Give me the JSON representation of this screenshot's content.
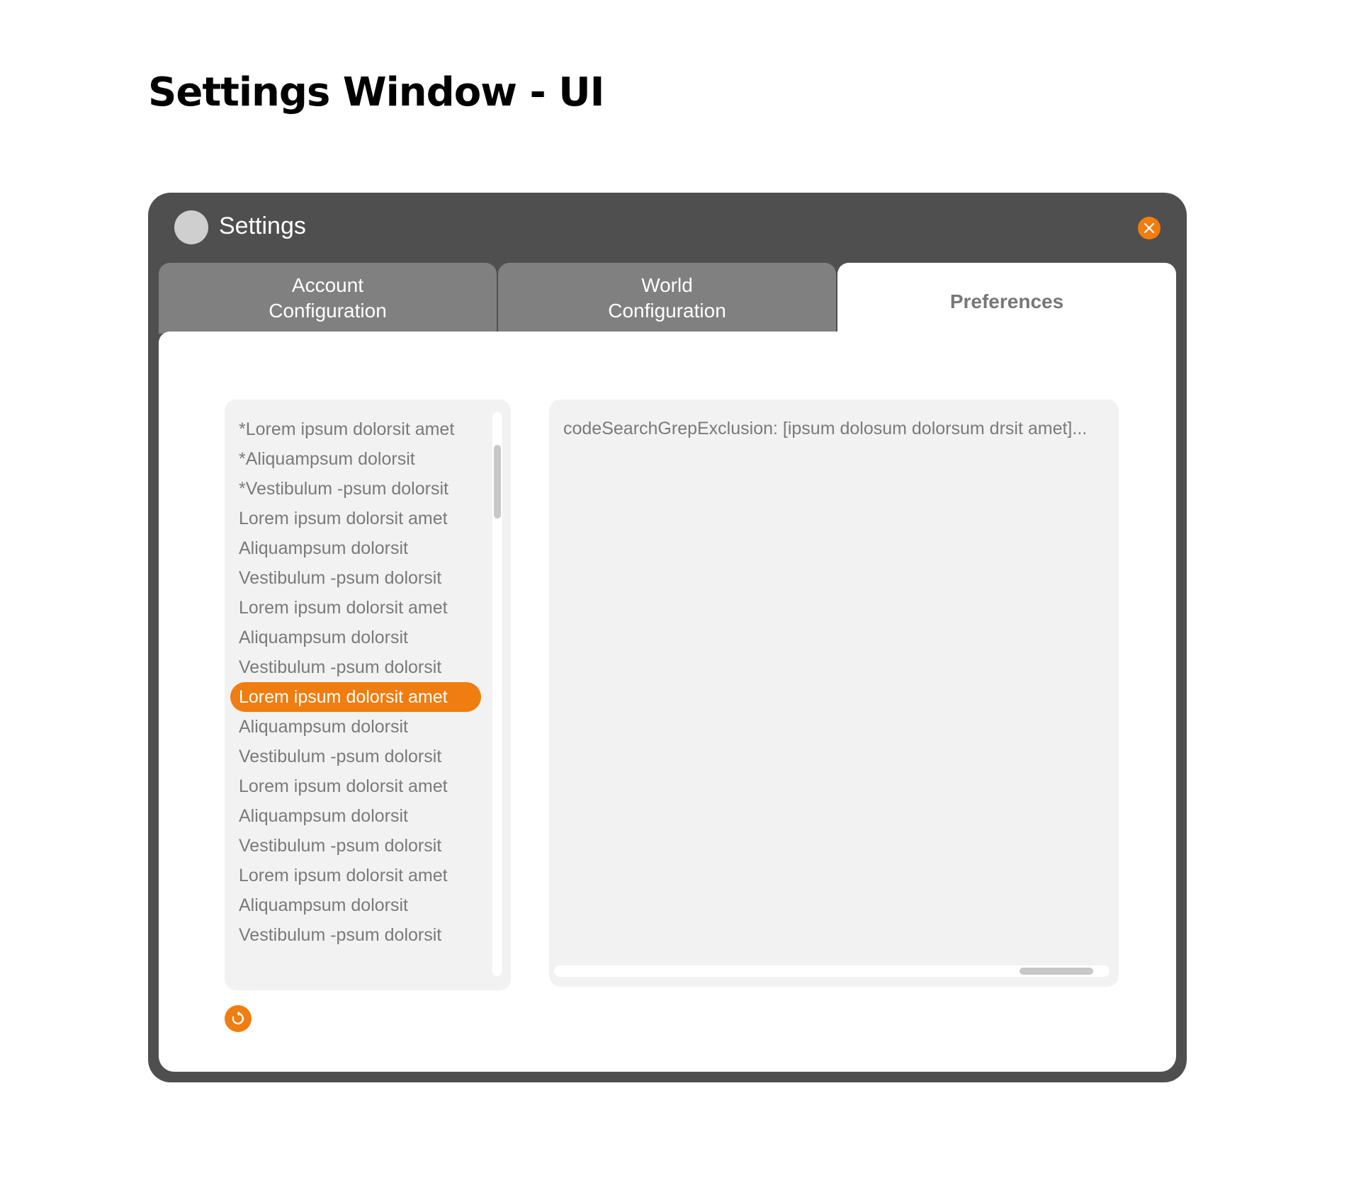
{
  "page": {
    "title": "Settings Window - UI"
  },
  "window": {
    "title": "Settings",
    "accent_color": "#f07d0f",
    "frame_color": "#4f4f4f",
    "close_icon": "close-icon",
    "refresh_icon": "refresh-icon"
  },
  "tabs": [
    {
      "label": "Account\nConfiguration",
      "active": false
    },
    {
      "label": "World\nConfiguration",
      "active": false
    },
    {
      "label": "Preferences",
      "active": true
    }
  ],
  "settings_list": {
    "selected_index": 9,
    "items": [
      "*Lorem ipsum dolorsit amet",
      "*Aliquampsum dolorsit",
      "*Vestibulum -psum dolorsit",
      "Lorem ipsum dolorsit amet",
      "Aliquampsum dolorsit",
      "Vestibulum -psum dolorsit",
      "Lorem ipsum dolorsit amet",
      "Aliquampsum dolorsit",
      "Vestibulum -psum dolorsit",
      "Lorem ipsum dolorsit amet",
      "Aliquampsum dolorsit",
      "Vestibulum -psum dolorsit",
      "Lorem ipsum dolorsit amet",
      "Aliquampsum dolorsit",
      "Vestibulum -psum dolorsit",
      "Lorem ipsum dolorsit amet",
      "Aliquampsum dolorsit",
      "Vestibulum -psum dolorsit"
    ]
  },
  "editor": {
    "text": "codeSearchGrepExclusion: [ipsum dolosum dolorsum drsit amet]..."
  }
}
